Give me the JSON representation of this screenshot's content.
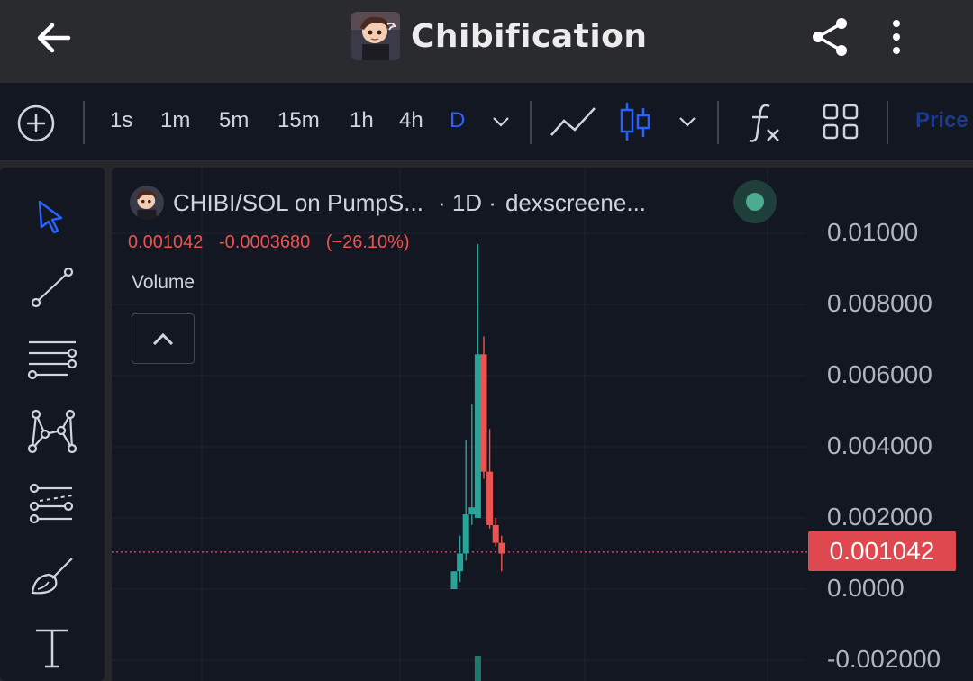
{
  "header": {
    "title": "Chibification"
  },
  "toolbar": {
    "timeframes": [
      "1s",
      "1m",
      "5m",
      "15m",
      "1h",
      "4h",
      "D"
    ],
    "active_timeframe": "D",
    "price_tab": "Price"
  },
  "legend": {
    "symbol": "CHIBI/SOL on PumpS...",
    "interval": "· 1D ·",
    "source": "dexscreene...",
    "last": "0.001042",
    "change": "-0.0003680",
    "change_pct": "(−26.10%)",
    "volume_label": "Volume"
  },
  "price_axis": {
    "labels": [
      "0.01000",
      "0.008000",
      "0.006000",
      "0.004000",
      "0.002000",
      "0.0000",
      "-0.002000"
    ],
    "current_price": "0.001042"
  },
  "colors": {
    "up": "#26a69a",
    "down": "#ef5350",
    "accent": "#2962ff",
    "background": "#131722"
  },
  "chart_data": {
    "type": "candlestick",
    "ylim": [
      -0.0025,
      0.0115
    ],
    "current_price": 0.001042,
    "candles": [
      {
        "open": 0.0,
        "high": 0.0005,
        "low": 0.0,
        "close": 0.0005,
        "dir": "up"
      },
      {
        "open": 0.0005,
        "high": 0.0015,
        "low": 0.0002,
        "close": 0.001,
        "dir": "up"
      },
      {
        "open": 0.001,
        "high": 0.0042,
        "low": 0.0008,
        "close": 0.0021,
        "dir": "up"
      },
      {
        "open": 0.0021,
        "high": 0.0052,
        "low": 0.0018,
        "close": 0.0023,
        "dir": "up"
      },
      {
        "open": 0.002,
        "high": 0.0097,
        "low": 0.002,
        "close": 0.0066,
        "dir": "up"
      },
      {
        "open": 0.0066,
        "high": 0.0071,
        "low": 0.0031,
        "close": 0.0033,
        "dir": "down"
      },
      {
        "open": 0.0033,
        "high": 0.0045,
        "low": 0.0017,
        "close": 0.0018,
        "dir": "down"
      },
      {
        "open": 0.0018,
        "high": 0.002,
        "low": 0.0012,
        "close": 0.0013,
        "dir": "down"
      },
      {
        "open": 0.0013,
        "high": 0.0015,
        "low": 0.0005,
        "close": 0.001,
        "dir": "down"
      }
    ],
    "volume": [
      {
        "value": 0.0,
        "dir": "up"
      },
      {
        "value": 0.0,
        "dir": "up"
      },
      {
        "value": 0.0,
        "dir": "up"
      },
      {
        "value": 0.0,
        "dir": "up"
      },
      {
        "value": 1.0,
        "dir": "up"
      },
      {
        "value": 0.0,
        "dir": "down"
      },
      {
        "value": 0.0,
        "dir": "down"
      },
      {
        "value": 0.0,
        "dir": "down"
      },
      {
        "value": 0.0,
        "dir": "down"
      }
    ]
  }
}
